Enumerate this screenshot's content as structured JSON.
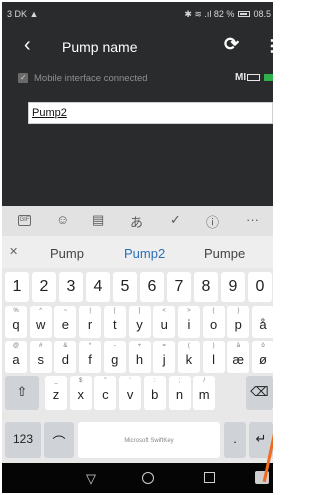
{
  "status_bar": {
    "left": "3 DK ▲",
    "right_icons": "✱ ≋ .ıl",
    "battery_percent": "82 %",
    "time_partial": "08.5"
  },
  "app_bar": {
    "back_icon": "chevron-left-icon",
    "title": "Pump name",
    "refresh_icon": "refresh-icon",
    "more_icon": "more-vert-icon"
  },
  "connection": {
    "checked": true,
    "label": "Mobile interface connected",
    "device_label": "MI"
  },
  "input": {
    "value": "Pump2"
  },
  "keyboard": {
    "toolbar_icons": [
      "gif-icon",
      "sticker-icon",
      "clipboard-icon",
      "translate-icon",
      "check-icon",
      "info-icon",
      "more-horiz-icon"
    ],
    "toolbar": {
      "gif": "GIF",
      "more": "···"
    },
    "suggestions": [
      "Pump",
      "Pump2",
      "Pumpe"
    ],
    "number_row": [
      "1",
      "2",
      "3",
      "4",
      "5",
      "6",
      "7",
      "8",
      "9",
      "0"
    ],
    "row1": [
      {
        "key": "q",
        "hint": "%"
      },
      {
        "key": "w",
        "hint": "^"
      },
      {
        "key": "e",
        "hint": "~"
      },
      {
        "key": "r",
        "hint": "|"
      },
      {
        "key": "t",
        "hint": "["
      },
      {
        "key": "y",
        "hint": "]"
      },
      {
        "key": "u",
        "hint": "<"
      },
      {
        "key": "i",
        "hint": ">"
      },
      {
        "key": "o",
        "hint": "{"
      },
      {
        "key": "p",
        "hint": "}"
      },
      {
        "key": "å",
        "hint": ""
      }
    ],
    "row2": [
      {
        "key": "a",
        "hint": "@"
      },
      {
        "key": "s",
        "hint": "#"
      },
      {
        "key": "d",
        "hint": "&"
      },
      {
        "key": "f",
        "hint": "*"
      },
      {
        "key": "g",
        "hint": "-"
      },
      {
        "key": "h",
        "hint": "+"
      },
      {
        "key": "j",
        "hint": "="
      },
      {
        "key": "k",
        "hint": "("
      },
      {
        "key": "l",
        "hint": ")"
      },
      {
        "key": "æ",
        "hint": "ä"
      },
      {
        "key": "ø",
        "hint": "ö"
      }
    ],
    "row3": [
      {
        "key": "z",
        "hint": "_"
      },
      {
        "key": "x",
        "hint": "$"
      },
      {
        "key": "c",
        "hint": "\""
      },
      {
        "key": "v",
        "hint": "'"
      },
      {
        "key": "b",
        "hint": ":"
      },
      {
        "key": "n",
        "hint": ";"
      },
      {
        "key": "m",
        "hint": "/"
      }
    ],
    "shift_icon": "shift-icon",
    "backspace_icon": "backspace-icon",
    "numbers_key": "123",
    "mic_icon": "mic-icon",
    "space_brand": "Microsoft SwiftKey",
    "period_key": ".",
    "enter_icon": "enter-icon"
  },
  "nav_bar": {
    "icons": [
      "nav-back-icon",
      "nav-home-icon",
      "nav-recents-icon",
      "keyboard-icon"
    ]
  },
  "accent_colors": {
    "suggestion_selected": "#2a6fb8",
    "device_status": "#2fb24a",
    "pointer": "#f06a20"
  }
}
